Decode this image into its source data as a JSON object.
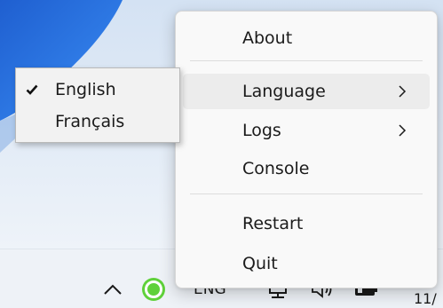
{
  "tray_menu": {
    "items": [
      {
        "label": "About"
      },
      {
        "label": "Language",
        "has_submenu": true
      },
      {
        "label": "Logs",
        "has_submenu": true
      },
      {
        "label": "Console"
      },
      {
        "label": "Restart"
      },
      {
        "label": "Quit"
      }
    ]
  },
  "language_submenu": {
    "items": [
      {
        "label": "English",
        "checked": true
      },
      {
        "label": "Français",
        "checked": false
      }
    ]
  },
  "taskbar": {
    "language_indicator": "ENG",
    "clock_fragment_time": ":",
    "clock_fragment_date": "11/"
  },
  "icons": {
    "tray_overflow": "chevron-up-icon",
    "app": "app-ring-icon",
    "network": "network-icon",
    "volume": "volume-icon",
    "battery": "battery-icon",
    "submenu": "chevron-right-icon",
    "checked": "checkmark-icon"
  },
  "colors": {
    "menu_background": "#f9f9f9",
    "menu_hover": "#ececec",
    "submenu_background": "#f2f2f2",
    "app_icon": "#5fd13a",
    "wallpaper_accent": "#1e5bc6"
  }
}
